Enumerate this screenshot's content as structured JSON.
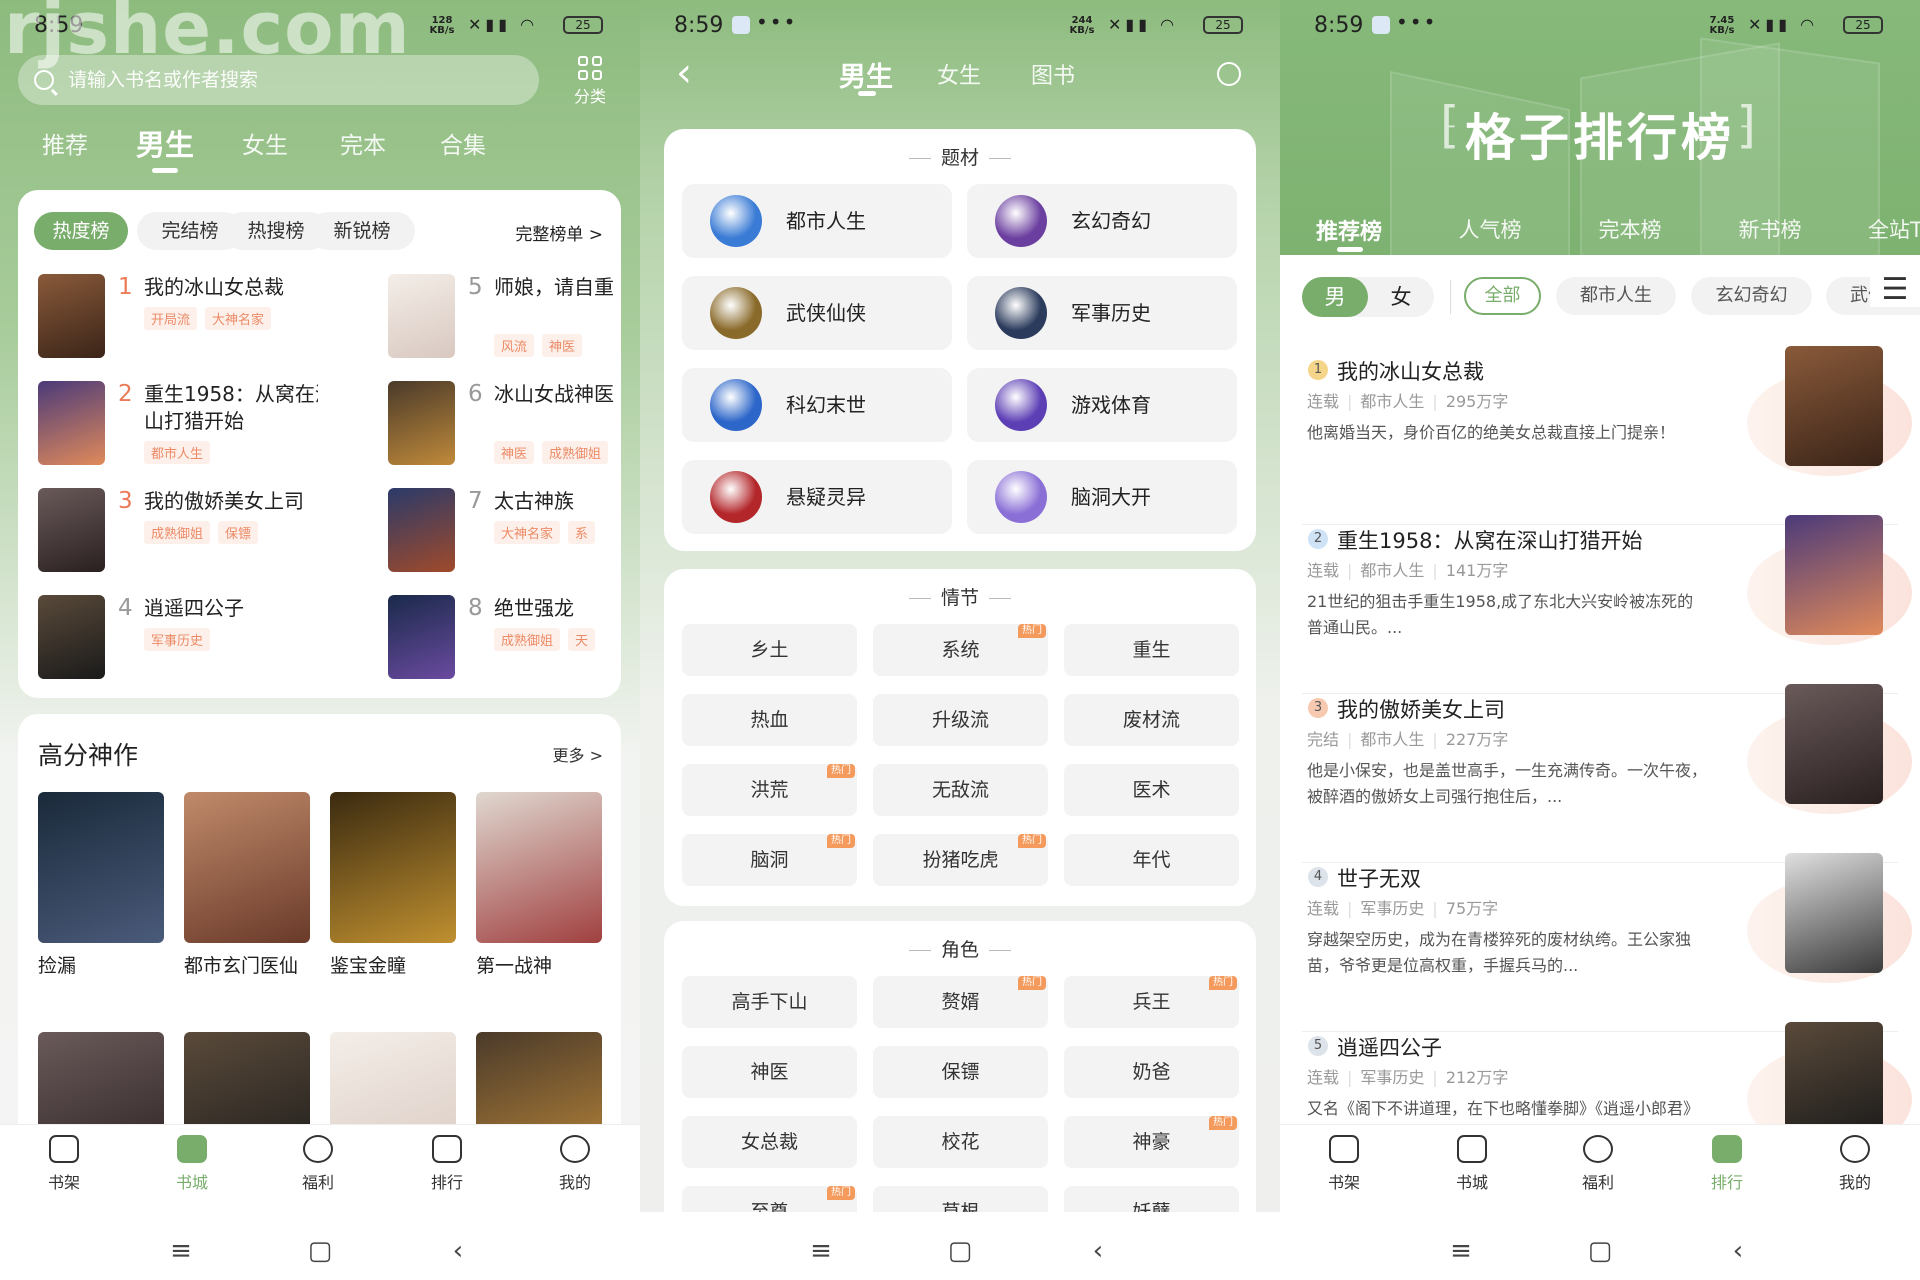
{
  "watermark": "rjshe.com",
  "status": {
    "time": "8:59",
    "dots": "•••",
    "battery": "25",
    "speeds": [
      "128 KB/s",
      "244 KB/s",
      "7.45 KB/s"
    ]
  },
  "colors": {
    "brand": "#79ad6c",
    "rank_hot": "#ec7a56",
    "tag_text": "#ec8a66",
    "hot_badge": "#f39a5c"
  },
  "store": {
    "search_placeholder": "请输入书名或作者搜索",
    "category_label": "分类",
    "tabs": [
      {
        "label": "推荐"
      },
      {
        "label": "男生",
        "active": true
      },
      {
        "label": "女生"
      },
      {
        "label": "完本"
      },
      {
        "label": "合集"
      }
    ],
    "chart_pills": [
      {
        "label": "热度榜",
        "active": true
      },
      {
        "label": "完结榜"
      },
      {
        "label": "热搜榜"
      },
      {
        "label": "新锐榜"
      }
    ],
    "full_list_label": "完整榜单 >",
    "ranking": [
      {
        "rank": "1",
        "title": "我的冰山女总裁",
        "tags": [
          "开局流",
          "大神名家"
        ]
      },
      {
        "rank": "2",
        "title": "重生1958：从窝在深山打猎开始",
        "tags": [
          "都市人生"
        ]
      },
      {
        "rank": "3",
        "title": "我的傲娇美女上司",
        "tags": [
          "成熟御姐",
          "保镖"
        ]
      },
      {
        "rank": "4",
        "title": "逍遥四公子",
        "tags": [
          "军事历史"
        ]
      },
      {
        "rank": "5",
        "title": "师娘，请自重",
        "tags": [
          "风流",
          "神医"
        ]
      },
      {
        "rank": "6",
        "title": "冰山女战神医",
        "tags": [
          "神医",
          "成熟御姐"
        ]
      },
      {
        "rank": "7",
        "title": "太古神族",
        "tags": [
          "大神名家",
          "系"
        ]
      },
      {
        "rank": "8",
        "title": "绝世强龙",
        "tags": [
          "成熟御姐",
          "天"
        ]
      }
    ],
    "high_score": {
      "title": "高分神作",
      "more": "更多 >",
      "books": [
        {
          "title": "捡漏"
        },
        {
          "title": "都市玄门医仙"
        },
        {
          "title": "鉴宝金瞳"
        },
        {
          "title": "第一战神"
        }
      ]
    },
    "nav": [
      {
        "label": "书架",
        "icon": "bookshelf-icon"
      },
      {
        "label": "书城",
        "icon": "store-icon",
        "active": true
      },
      {
        "label": "福利",
        "icon": "gift-icon"
      },
      {
        "label": "排行",
        "icon": "ranking-icon"
      },
      {
        "label": "我的",
        "icon": "profile-icon"
      }
    ]
  },
  "categories": {
    "tabs": [
      {
        "label": "男生",
        "active": true
      },
      {
        "label": "女生"
      },
      {
        "label": "图书"
      }
    ],
    "sections": [
      {
        "title": "题材",
        "items": [
          {
            "label": "都市人生",
            "color": "#3a7bd5"
          },
          {
            "label": "玄幻奇幻",
            "color": "#6b3fa0"
          },
          {
            "label": "武侠仙侠",
            "color": "#8a6a2a"
          },
          {
            "label": "军事历史",
            "color": "#2b3b5c"
          },
          {
            "label": "科幻末世",
            "color": "#2c66c9"
          },
          {
            "label": "游戏体育",
            "color": "#5d3fb5"
          },
          {
            "label": "悬疑灵异",
            "color": "#b3262a"
          },
          {
            "label": "脑洞大开",
            "color": "#8a6fd6"
          }
        ]
      },
      {
        "title": "情节",
        "items": [
          {
            "label": "乡土"
          },
          {
            "label": "系统",
            "hot": true
          },
          {
            "label": "重生"
          },
          {
            "label": "热血"
          },
          {
            "label": "升级流"
          },
          {
            "label": "废材流"
          },
          {
            "label": "洪荒",
            "hot": true
          },
          {
            "label": "无敌流"
          },
          {
            "label": "医术"
          },
          {
            "label": "脑洞",
            "hot": true
          },
          {
            "label": "扮猪吃虎",
            "hot": true
          },
          {
            "label": "年代"
          }
        ]
      },
      {
        "title": "角色",
        "items": [
          {
            "label": "高手下山"
          },
          {
            "label": "赘婿",
            "hot": true
          },
          {
            "label": "兵王",
            "hot": true
          },
          {
            "label": "神医"
          },
          {
            "label": "保镖"
          },
          {
            "label": "奶爸"
          },
          {
            "label": "女总裁"
          },
          {
            "label": "校花"
          },
          {
            "label": "神豪",
            "hot": true
          },
          {
            "label": "至尊",
            "hot": true
          },
          {
            "label": "草根"
          },
          {
            "label": "妖孽"
          }
        ]
      }
    ],
    "hot_label": "热门"
  },
  "ranking_page": {
    "title": "格子排行榜",
    "tabs": [
      {
        "label": "推荐榜",
        "active": true
      },
      {
        "label": "人气榜"
      },
      {
        "label": "完本榜"
      },
      {
        "label": "新书榜"
      },
      {
        "label": "全站TOP"
      }
    ],
    "gender": [
      {
        "label": "男",
        "active": true
      },
      {
        "label": "女"
      }
    ],
    "filters": [
      {
        "label": "全部",
        "active": true
      },
      {
        "label": "都市人生"
      },
      {
        "label": "玄幻奇幻"
      },
      {
        "label": "武侠仙侠"
      }
    ],
    "books": [
      {
        "rank": "1",
        "title": "我的冰山女总裁",
        "status": "连载",
        "genre": "都市人生",
        "words": "295万字",
        "desc": "他离婚当天，身价百亿的绝美女总裁直接上门提亲！"
      },
      {
        "rank": "2",
        "title": "重生1958：从窝在深山打猎开始",
        "status": "连载",
        "genre": "都市人生",
        "words": "141万字",
        "desc": "21世纪的狙击手重生1958,成了东北大兴安岭被冻死的普通山民。..."
      },
      {
        "rank": "3",
        "title": "我的傲娇美女上司",
        "status": "完结",
        "genre": "都市人生",
        "words": "227万字",
        "desc": "他是小保安，也是盖世高手，一生充满传奇。一次午夜，被醉酒的傲娇女上司强行抱住后，..."
      },
      {
        "rank": "4",
        "title": "世子无双",
        "status": "连载",
        "genre": "军事历史",
        "words": "75万字",
        "desc": "穿越架空历史，成为在青楼猝死的废材纨绔。王公家独苗，爷爷更是位高权重，手握兵马的..."
      },
      {
        "rank": "5",
        "title": "逍遥四公子",
        "status": "连载",
        "genre": "军事历史",
        "words": "212万字",
        "desc": "又名《阁下不讲道理，在下也略懂拳脚》《逍遥小郎君》《极品四公子》"
      }
    ],
    "nav": [
      {
        "label": "书架",
        "icon": "bookshelf-icon"
      },
      {
        "label": "书城",
        "icon": "store-icon"
      },
      {
        "label": "福利",
        "icon": "gift-icon"
      },
      {
        "label": "排行",
        "icon": "ranking-icon",
        "active": true
      },
      {
        "label": "我的",
        "icon": "profile-icon"
      }
    ]
  },
  "sysnav": {
    "menu": "≡",
    "home": "▢",
    "back": "‹"
  }
}
